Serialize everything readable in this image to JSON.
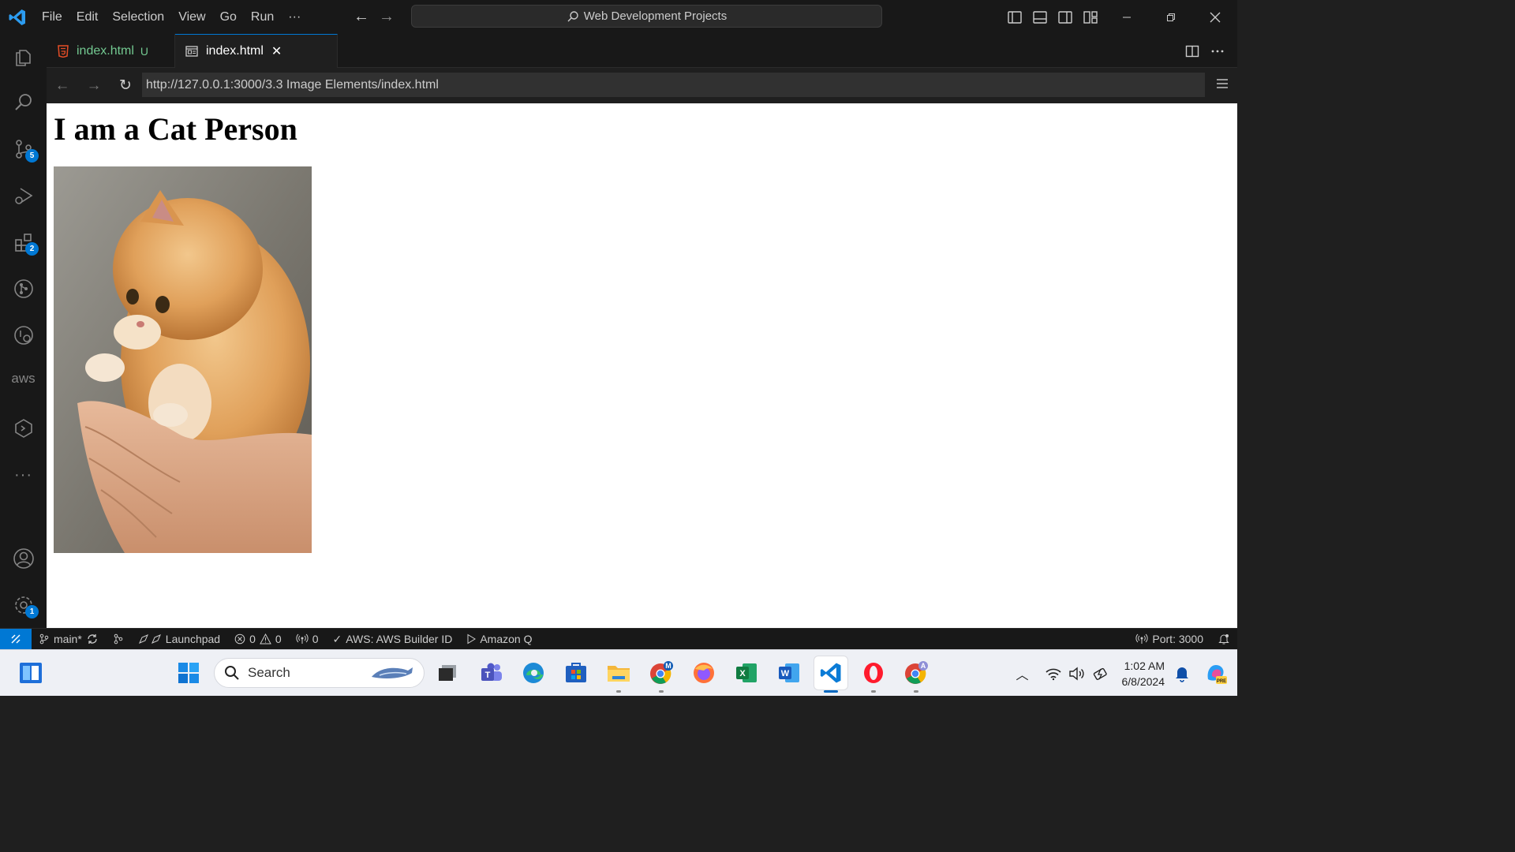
{
  "menu": {
    "items": [
      "File",
      "Edit",
      "Selection",
      "View",
      "Go",
      "Run"
    ],
    "more": "···"
  },
  "command_center": {
    "title": "Web Development Projects"
  },
  "activity_bar": {
    "source_control_badge": "5",
    "extensions_badge": "2",
    "settings_badge": "1",
    "aws_label": "aws",
    "more": "···"
  },
  "tabs": [
    {
      "label": "index.html",
      "status": "U"
    },
    {
      "label": "index.html",
      "close": "✕"
    }
  ],
  "browser": {
    "url": "http://127.0.0.1:3000/3.3 Image Elements/index.html"
  },
  "page": {
    "heading": "I am a Cat Person"
  },
  "status_bar": {
    "branch": "main*",
    "launchpad": "Launchpad",
    "errors": "0",
    "warnings": "0",
    "ports_count": "0",
    "aws": "AWS: AWS Builder ID",
    "amazon_q": "Amazon Q",
    "port": "Port: 3000"
  },
  "taskbar": {
    "search_placeholder": "Search",
    "chrome_profile_1": "M",
    "chrome_profile_2": "A"
  },
  "clock": {
    "time": "1:02 AM",
    "date": "6/8/2024"
  },
  "colors": {
    "accent": "#0078d4",
    "untracked": "#73c991",
    "html_icon": "#e44d26"
  }
}
